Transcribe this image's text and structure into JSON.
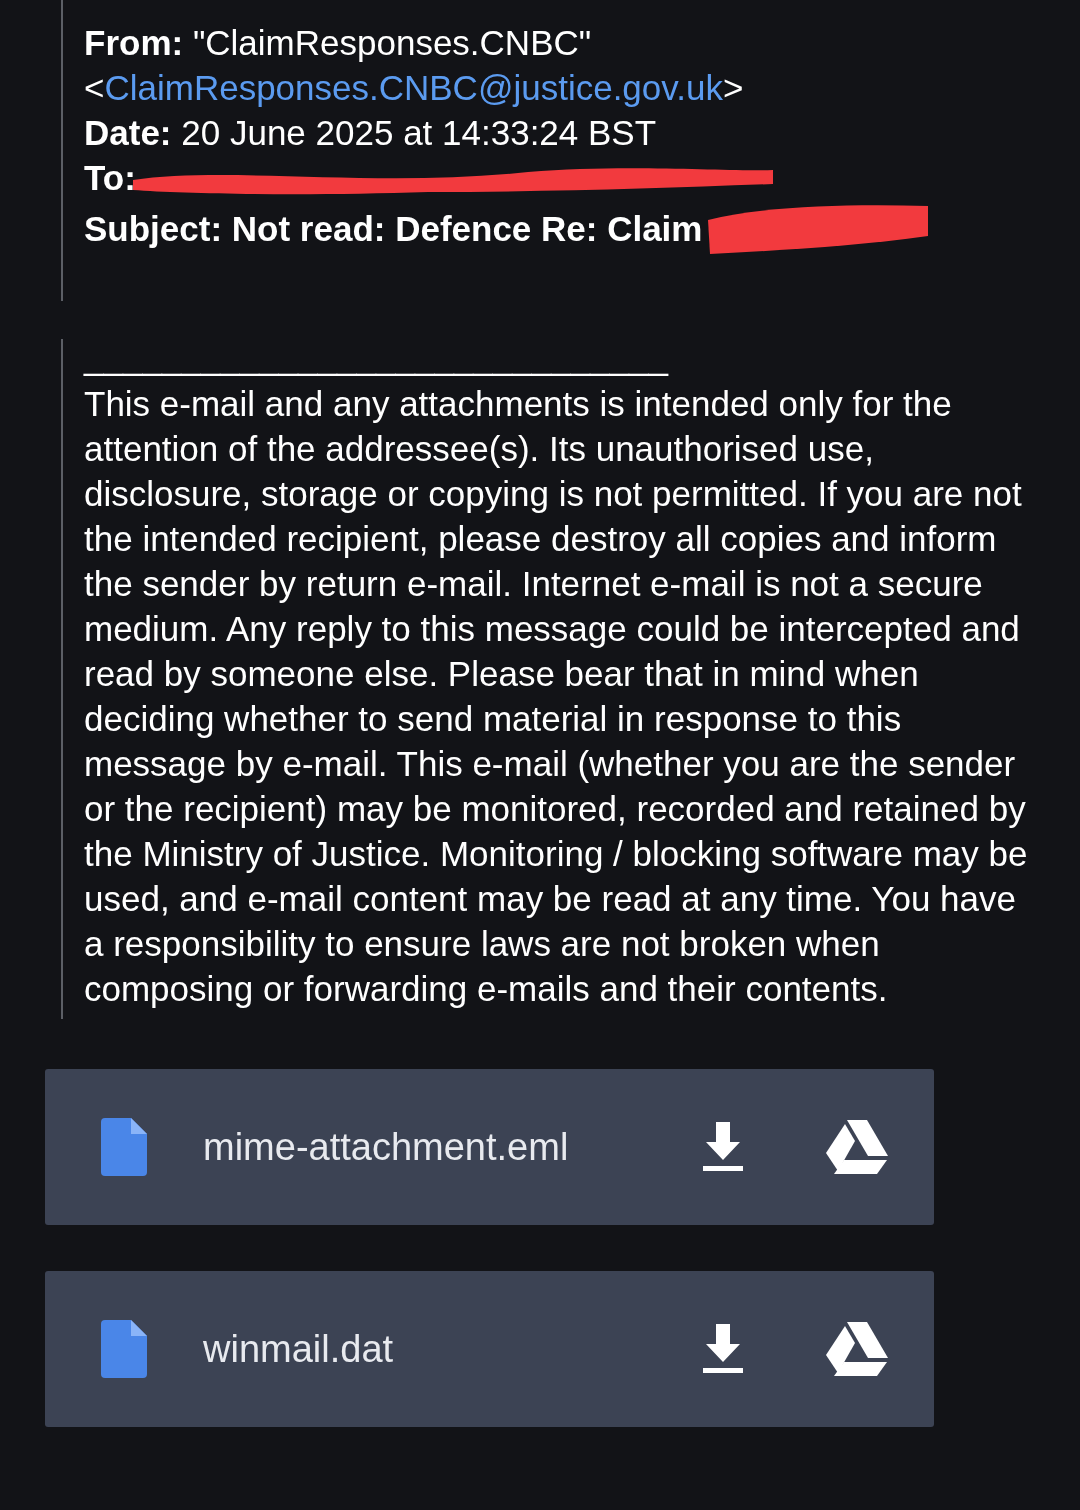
{
  "header": {
    "from_label": "From:",
    "from_name": "\"ClaimResponses.CNBC\"",
    "from_email_open": "<",
    "from_email": "ClaimResponses.CNBC@justice.gov.uk",
    "from_email_close": ">",
    "date_label": "Date:",
    "date": "20 June 2025 at 14:33:24 BST",
    "to_label": "To:",
    "subject": "Subject: Not read: Defence Re: Claim"
  },
  "body": {
    "rule": "______________________________",
    "text": "This e-mail and any attachments is intended only for the attention of the addressee(s). Its unauthorised use, disclosure, storage or copying is not permitted. If you are not the intended recipient, please destroy all copies and inform the sender by return e-mail. Internet e-mail is not a secure medium. Any reply to this message could be intercepted and read by someone else. Please bear that in mind when deciding whether to send material in response to this message by e-mail. This e-mail (whether you are the sender or the recipient) may be monitored, recorded and retained by the Ministry of Justice. Monitoring / blocking software may be used, and e-mail content may be read at any time. You have a responsibility to ensure laws are not broken when composing or forwarding e-mails and their contents."
  },
  "attachments": [
    {
      "name": "mime-attachment.eml"
    },
    {
      "name": "winmail.dat"
    }
  ]
}
